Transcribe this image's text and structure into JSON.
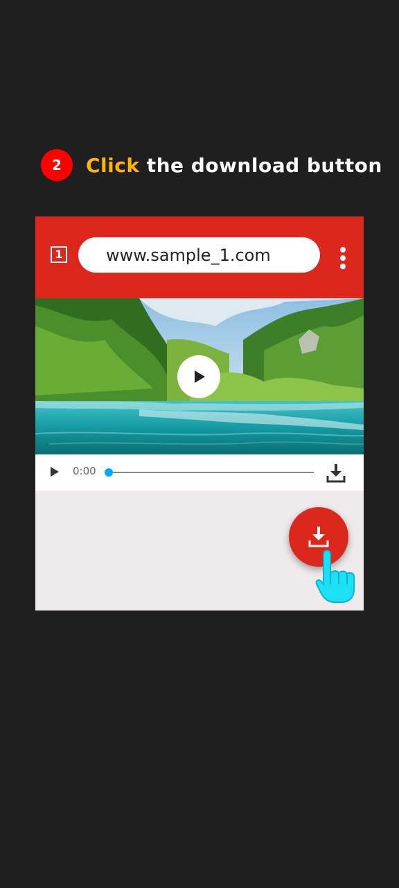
{
  "step": {
    "number": "2",
    "highlight": "Click",
    "rest": " the download button"
  },
  "browser": {
    "tab_icon_label": "1",
    "url": "www.sample_1.com",
    "menu_icon": "more-vert-icon"
  },
  "player": {
    "time": "0:00",
    "progress": 0
  },
  "colors": {
    "background": "#1f1f1f",
    "brand_red": "#dc271c",
    "badge_red": "#ff0000",
    "highlight": "#ffb400",
    "progress_knob": "#00a8ff",
    "hand": "#1ee0f5"
  }
}
